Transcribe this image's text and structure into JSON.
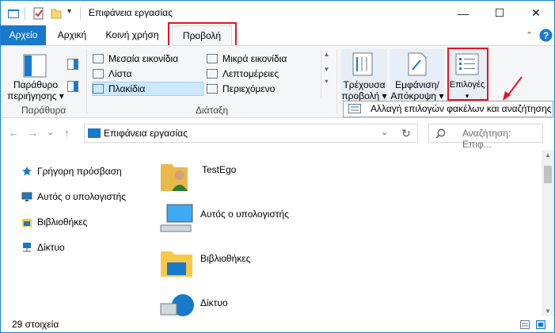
{
  "window": {
    "title": "Επιφάνεια εργασίας",
    "controls": {
      "minimize": "—",
      "maximize": "☐",
      "close": "✕"
    }
  },
  "tabs": [
    {
      "label": "Αρχείο"
    },
    {
      "label": "Αρχική"
    },
    {
      "label": "Κοινή χρήση"
    },
    {
      "label": "Προβολή"
    }
  ],
  "ribbon": {
    "panes": {
      "nav_pane_label": "Παράθυρο περιήγησης ▾",
      "nav_pane_line1": "Παράθυρο",
      "nav_pane_line2": "περιήγησης ▾",
      "group": "Παράθυρα"
    },
    "layout": {
      "items": [
        "Μεσαία εικονίδια",
        "Μικρά εικονίδια",
        "Λίστα",
        "Λεπτομέρειες",
        "Πλακίδια",
        "Περιεχόμενο"
      ],
      "selected": "Πλακίδια",
      "group": "Διάταξη"
    },
    "current_view": {
      "line1": "Τρέχουσα",
      "line2": "προβολή ▾"
    },
    "show_hide": {
      "line1": "Εμφάνιση/",
      "line2": "Απόκρυψη ▾"
    },
    "options": {
      "label": "Επιλογές",
      "arrow": "▾"
    }
  },
  "tooltip": {
    "text": "Αλλαγή επιλογών φακέλων και αναζήτησης"
  },
  "address": {
    "path": "Επιφάνεια εργασίας",
    "refresh": "↻",
    "dropdown": "⌄"
  },
  "search": {
    "placeholder": "Αναζήτηση: Επιφ..."
  },
  "nav_buttons": {
    "back": "←",
    "forward": "→",
    "recent": "⌄",
    "up": "↑"
  },
  "nav_pane": [
    {
      "label": "Γρήγορη πρόσβαση"
    },
    {
      "label": "Αυτός ο υπολογιστής"
    },
    {
      "label": "Βιβλιοθήκες"
    },
    {
      "label": "Δίκτυο"
    }
  ],
  "content": [
    {
      "label": "TestEgo"
    },
    {
      "label": "Αυτός ο υπολογιστής"
    },
    {
      "label": "Βιβλιοθήκες"
    },
    {
      "label": "Δίκτυο"
    }
  ],
  "status": {
    "count": "29 στοιχεία"
  },
  "colors": {
    "accent": "#1979ca",
    "highlight": "#e81123",
    "selected_bg": "#cce8ff"
  }
}
